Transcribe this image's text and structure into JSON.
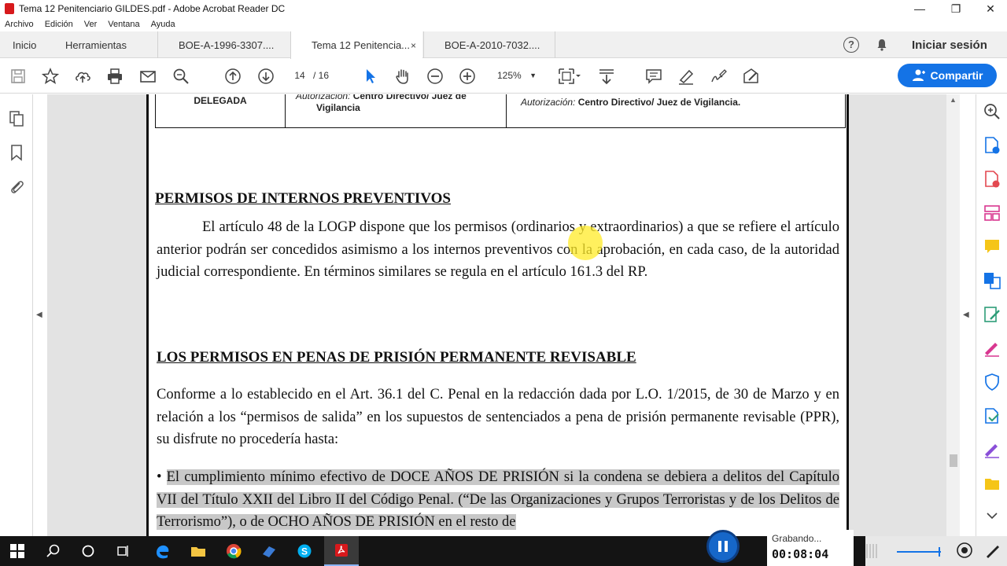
{
  "window": {
    "title": "Tema 12 Penitenciario GILDES.pdf - Adobe Acrobat Reader DC",
    "minimize": "—",
    "maximize": "❐",
    "close": "✕"
  },
  "menu": [
    "Archivo",
    "Edición",
    "Ver",
    "Ventana",
    "Ayuda"
  ],
  "tabs": {
    "home": "Inicio",
    "tools": "Herramientas",
    "documents": [
      {
        "label": "BOE-A-1996-3307....",
        "active": false,
        "closable": false
      },
      {
        "label": "Tema 12 Penitencia...",
        "active": true,
        "closable": true
      },
      {
        "label": "BOE-A-2010-7032....",
        "active": false,
        "closable": false
      }
    ],
    "close_glyph": "×",
    "sign_in": "Iniciar sesión",
    "help_glyph": "?"
  },
  "toolbar": {
    "page_current": "14",
    "page_total": "/ 16",
    "zoom": "125%",
    "share": "Compartir",
    "icons": [
      "save-icon",
      "star-icon",
      "upload-icon",
      "print-icon",
      "mail-icon",
      "search-icon",
      "prev-page-icon",
      "next-page-icon",
      "select-arrow-icon",
      "hand-icon",
      "zoom-out-icon",
      "zoom-in-icon",
      "fit-page-icon",
      "scroll-mode-icon",
      "comment-icon",
      "highlight-icon",
      "sign-icon",
      "fill-sign-icon"
    ]
  },
  "document": {
    "table": {
      "col1": "DELEGADA",
      "col2_prefix": "Autorización:",
      "col2_bold": "Centro Directivo/ Juez de",
      "col2_line2": "Vigilancia",
      "col3_prefix": "Autorización:",
      "col3_bold": "Centro Directivo/ Juez de Vigilancia."
    },
    "heading1": "PERMISOS DE INTERNOS PREVENTIVOS",
    "para1": "El artículo 48 de la LOGP dispone que los permisos (ordinarios y extraordinarios) a que se refiere el artículo anterior podrán ser concedidos asimismo a los internos preventivos con la aprobación, en cada caso, de la autoridad judicial correspondiente. En términos similares se regula en el artículo 161.3 del RP.",
    "heading2": "LOS PERMISOS EN PENAS DE PRISIÓN PERMANENTE REVISABLE",
    "para2": "Conforme a lo establecido en el Art. 36.1 del C. Penal en la redacción dada por L.O. 1/2015, de 30 de Marzo y en relación a los “permisos de salida” en los supuestos de sentenciados a pena de prisión permanente revisable (PPR), su disfrute no procedería hasta:",
    "bullet": "•",
    "para3": "El cumplimiento mínimo efectivo de DOCE AÑOS DE PRISIÓN si la condena se debiera a delitos del Capítulo VII del Título XXII del Libro II del Código Penal. (“De las Organizaciones y Grupos Terroristas y de los Delitos de Terrorismo”), o de OCHO AÑOS DE PRISIÓN en el resto de"
  },
  "recording": {
    "status": "Grabando...",
    "time": "00:08:04"
  },
  "colors": {
    "accent": "#1473e6",
    "pdf_red": "#d7191c"
  }
}
